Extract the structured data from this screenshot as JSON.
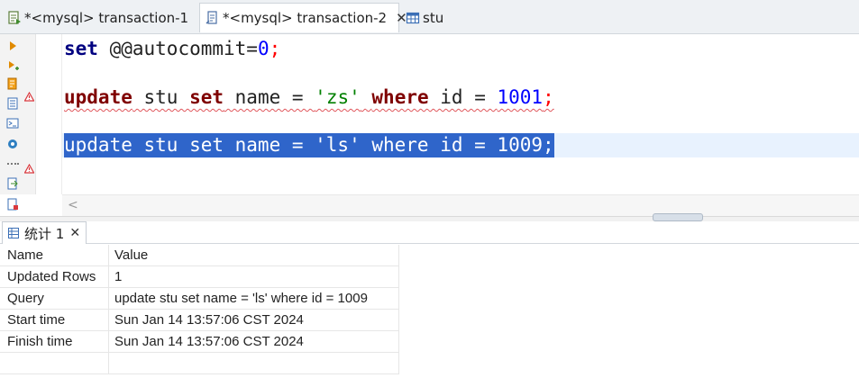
{
  "editor_tabs": [
    {
      "label": "*<mysql> transaction-1"
    },
    {
      "label": "*<mysql> transaction-2",
      "close": "✕"
    },
    {
      "label": "stu"
    }
  ],
  "editor": {
    "lines": [
      {
        "kw1": "set",
        "text1": " @@autocommit=",
        "num": "0",
        "semi": ";"
      },
      {
        "kw1": "update",
        "t1": " stu ",
        "kw2": "set",
        "t2": " name = ",
        "str": "'zs'",
        "t3": " ",
        "kw3": "where",
        "t4": " id = ",
        "num": "1001",
        "semi": ";"
      },
      {
        "text": "update stu set name = 'ls' where id = 1009;"
      }
    ],
    "scroll_left_glyph": "<"
  },
  "result_tab": {
    "label": "统计 1",
    "close": "✕"
  },
  "result_grid": {
    "rows": [
      {
        "name": "Name",
        "value": "Value"
      },
      {
        "name": "Updated Rows",
        "value": "1"
      },
      {
        "name": "Query",
        "value": "update stu set name = 'ls' where id = 1009"
      },
      {
        "name": "Start time",
        "value": "Sun Jan 14 13:57:06 CST 2024"
      },
      {
        "name": "Finish time",
        "value": "Sun Jan 14 13:57:06 CST 2024"
      },
      {
        "name": "",
        "value": ""
      }
    ]
  },
  "colors": {
    "selection": "#2f65ca",
    "keyword_update": "#7f0000",
    "keyword_set": "#000080",
    "string": "#008000",
    "number": "#0000ff",
    "error_squiggle": "#e0565b"
  },
  "icons": {
    "tab1": "sql-script-icon",
    "tab2": "sql-script-icon",
    "tab3": "table-icon",
    "gutter": [
      "execute-icon",
      "execute-script-icon",
      "explain-plan-icon",
      "load-script-icon",
      "terminal-icon",
      "settings-icon",
      "more-icon",
      "export-icon",
      "save-icon"
    ],
    "warnings": [
      "warning-icon",
      "warning-icon"
    ],
    "result_tab": "statistics-icon"
  }
}
